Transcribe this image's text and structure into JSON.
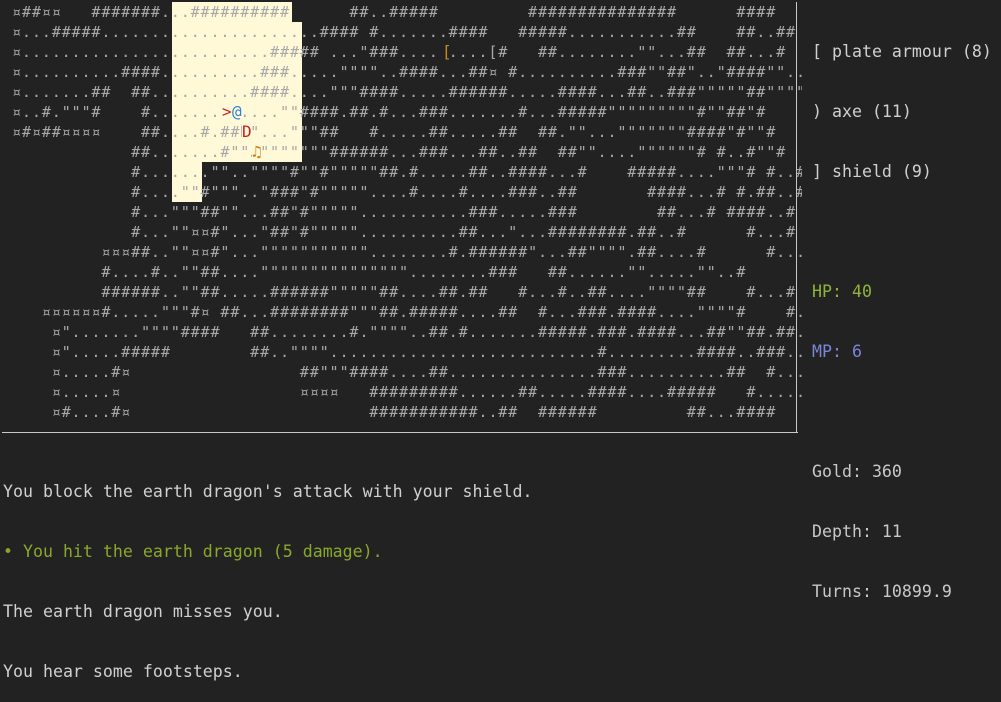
{
  "map": {
    "rows": [
      "¤##¤¤   #######...##########      ##..#####         ###############      ####",
      "¤...#####......................#### #.......####   #####...........##    ##..##",
      "¤.........................##### ...\"###.........[#   ##........\"\"...##  ##...#",
      "¤..........####..........###.....\"\"\"\"..####...##¤ #..........###\"\"##\"..\"####\"\"..#",
      "¤.......##  ##..........####....\"\"\"####.....######.....####...##..###\"\"\"\"\"##\"\"\"\"\"\"#",
      "¤..#.\"\"\"#    #.............\"\"####.##.#...###.......#...#####\"\"\"\"\"\"\"\"\"#\"\"##\"#",
      "¤#¤##¤¤¤¤    ##....#.##D\"...\"\"\"##   #.....##.....##  ##.\"\"...\"\"\"\"\"\"\"####\"#\"\"#",
      "            ##.......#\"\"♫\"\"\"\"\"\"\"######...###...##..##  ##\"\"....\"\"\"\"\"\"# #..#\"\"#",
      "            #.......\"\"..\"\"\"\"#\"\"#\"\"\"\"\"##.#.....##..####...#    #####....\"\"\"# #..#..#",
      "            #....\"\"#\"\"\"..\"###\"#\"\"\"\"\"....#....#....###..##       ####...# #.##..#",
      "            #...\"\"\"##\"\"...##\"#\"\"\"\"\"...........###.....###        ##...# ####..#",
      "            #...\"\"¤¤#\"...\"##\"#\"\"\"\"\"..........##...\"...########.##..#      #...#",
      "         ¤¤¤##..\"\"¤¤#\"...\"\"\"\"\"\"\"\"\"\"\"........#.######\"...##\"\"\"\".##....#      #...#",
      "         #....#..\"\"##....\"\"\"\"\"\"\"\"\"\"\"\"\"\"\"........###   ##......\"\".....\"\"..#      #...#",
      "         ######..\"\"##.....######\"\"\"\"\"##....##.##   #...#..##....\"\"\"\"##    #...#",
      "   ¤¤¤¤¤¤#.....\"\"\"#¤ ##...########\"\"\"##.#####....##  #...###.####....\"\"\"\"#    #...#",
      "    ¤\".......\"\"\"\"####   ##........#.\"\"\"\"..##.#.......#####.###.####...##\"\"##.##...#",
      "    ¤\".....#####        ##..\"\"\"\"...........................#.........####..###...",
      "    ¤.....#¤                 ##\"\"\"####....##...............###..........##  #....#...#",
      "    ¤.....¤                  ¤¤¤¤   #########......##.....####....#####   #.....###",
      "    ¤#....#¤                        ###########..##  ######         ##...####"
    ],
    "player_glyph": "@",
    "stairs_glyph": ">",
    "dragon_glyph": "D",
    "item_glyph": "[",
    "music_glyph": "♫",
    "colors": {
      "floor": "#a8a8a8",
      "lit": "#fff9d8",
      "player": "#2a7fd4",
      "stairs": "#cc2222",
      "dragon": "#c81e1e",
      "item": "#c98a1c",
      "music": "#d67a10"
    }
  },
  "inventory": [
    {
      "slot": "[",
      "name": "plate armour (8)"
    },
    {
      "slot": ")",
      "name": "axe (11)"
    },
    {
      "slot": "]",
      "name": "shield (9)"
    }
  ],
  "inventory_text": [
    "[ plate armour (8)",
    ") axe (11)",
    "] shield (9)"
  ],
  "stats": {
    "hp": "HP: 40",
    "mp": "MP: 6",
    "gold": "Gold: 360",
    "depth": "Depth: 11",
    "turns": "Turns: 10899.9"
  },
  "log": [
    "You block the earth dragon's attack with your shield.",
    "• You hit the earth dragon (5 damage).",
    "The earth dragon misses you.",
    "You hear some footsteps."
  ]
}
